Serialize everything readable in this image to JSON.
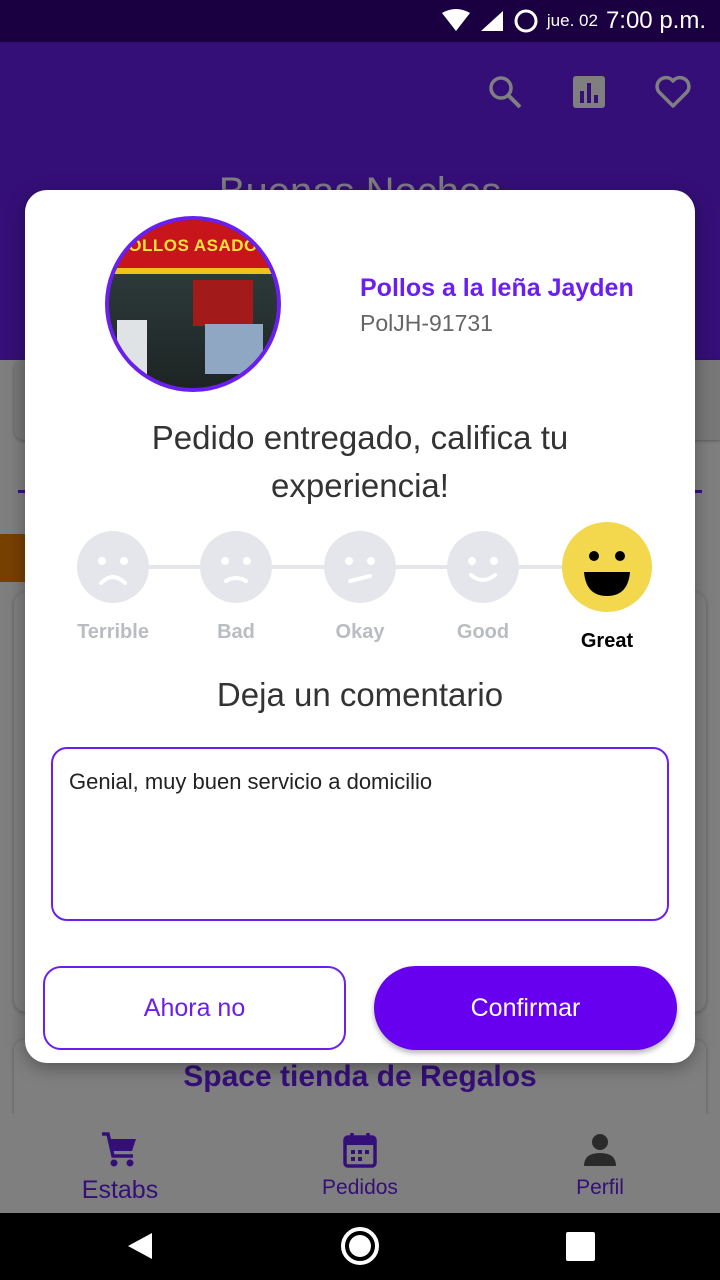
{
  "status_bar": {
    "date": "jue. 02",
    "time": "7:00 p.m."
  },
  "header": {
    "greeting": "Buenas Noches"
  },
  "background": {
    "store_name": "Space tienda de Regalos"
  },
  "dialog": {
    "store_name": "Pollos a la leña Jayden",
    "store_code": "PolJH-91731",
    "avatar_sign": "POLLOS ASADOS",
    "title": "Pedido entregado, califica tu experiencia!",
    "ratings": [
      "Terrible",
      "Bad",
      "Okay",
      "Good",
      "Great"
    ],
    "selected_rating": "Great",
    "comment_title": "Deja un comentario",
    "comment": "Genial, muy buen servicio a domicilio",
    "cancel_label": "Ahora no",
    "confirm_label": "Confirmar"
  },
  "bottom_nav": {
    "items": [
      "Estabs",
      "Pedidos",
      "Perfil"
    ],
    "active": "Estabs"
  },
  "colors": {
    "primary": "#6a1ff0",
    "selected_face": "#f3d74d",
    "inactive_face": "#e4e6eb"
  }
}
